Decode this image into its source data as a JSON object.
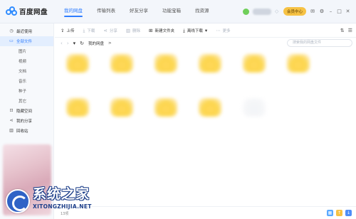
{
  "app": {
    "title": "百度网盘"
  },
  "nav": {
    "tabs": [
      {
        "label": "我的网盘"
      },
      {
        "label": "传输列表"
      },
      {
        "label": "好友分享"
      },
      {
        "label": "功能宝箱"
      },
      {
        "label": "找资源"
      }
    ]
  },
  "user": {
    "vip_label": "会员中心"
  },
  "sidebar": {
    "items": [
      {
        "label": "最近使用",
        "icon": "clock-icon"
      },
      {
        "label": "全部文件",
        "icon": "folder-icon"
      },
      {
        "label": "图片"
      },
      {
        "label": "视频"
      },
      {
        "label": "文档"
      },
      {
        "label": "音乐"
      },
      {
        "label": "种子"
      },
      {
        "label": "其它"
      },
      {
        "label": "隐藏空间",
        "icon": "lock-icon"
      },
      {
        "label": "我的分享",
        "icon": "share-icon"
      },
      {
        "label": "回收站",
        "icon": "trash-icon"
      }
    ]
  },
  "toolbar": {
    "upload": "上传",
    "download": "下载",
    "share": "分享",
    "delete": "删除",
    "new_folder": "新建文件夹",
    "offline_download": "离线下载",
    "more": "更多"
  },
  "path": {
    "crumb": "我的网盘",
    "separator": ">"
  },
  "search": {
    "placeholder": "搜索我的网盘文件"
  },
  "status": {
    "count": "13项"
  },
  "watermark": {
    "title": "系统之家",
    "subtitle": "XITONGZHIJIA.NET"
  },
  "colors": {
    "accent": "#2f7dff",
    "folder": "#fcd64d",
    "vip": "#f6c244"
  }
}
